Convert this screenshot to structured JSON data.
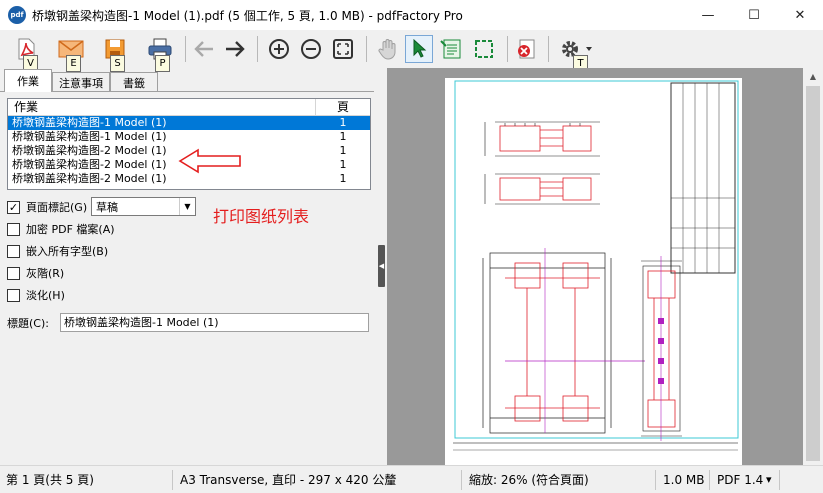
{
  "window": {
    "title": "桥墩钢盖梁构造图-1 Model (1).pdf (5 個工作, 5 頁, 1.0 MB) - pdfFactory Pro",
    "app_icon_text": "pdf",
    "minimize": "—",
    "maximize": "☐",
    "close": "✕"
  },
  "toolbar": {
    "icons": [
      "pdf-icon",
      "email-icon",
      "save-icon",
      "print-icon",
      "back-arrow-icon",
      "forward-arrow-icon",
      "zoom-in-icon",
      "zoom-out-icon",
      "fit-page-icon",
      "hand-icon",
      "select-arrow-icon",
      "text-select-icon",
      "region-select-icon",
      "delete-icon",
      "gear-icon"
    ],
    "key_tips": [
      "V",
      "E",
      "S",
      "P",
      "T"
    ],
    "accent": "#1a8a3a"
  },
  "tabs": [
    "作業",
    "注意事項",
    "書籤"
  ],
  "jobs": {
    "col_job": "作業",
    "col_pages": "頁",
    "rows": [
      {
        "name": "桥墩钢盖梁构造图-1 Model (1)",
        "pages": "1"
      },
      {
        "name": "桥墩钢盖梁构造图-1 Model (1)",
        "pages": "1"
      },
      {
        "name": "桥墩钢盖梁构造图-2 Model (1)",
        "pages": "1"
      },
      {
        "name": "桥墩钢盖梁构造图-2 Model (1)",
        "pages": "1"
      },
      {
        "name": "桥墩钢盖梁构造图-2 Model (1)",
        "pages": "1"
      }
    ]
  },
  "annotation": {
    "text": "打印图纸列表",
    "color": "#e41e1e"
  },
  "options": {
    "page_mark": "頁面標記(G)",
    "page_mark_value": "草稿",
    "encrypt": "加密 PDF 檔案(A)",
    "embed_fonts": "嵌入所有字型(B)",
    "grayscale": "灰階(R)",
    "fade": "淡化(H)",
    "check_mark": "✓"
  },
  "title_field": {
    "label": "標題(C):",
    "value": "桥墩钢盖梁构造图-1 Model (1)"
  },
  "statusbar": {
    "page": "第 1 頁(共 5 頁)",
    "paper": "A3 Transverse, 直印 - 297 x 420 公釐",
    "zoom": "縮放: 26% (符合頁面)",
    "size": "1.0 MB",
    "pdf_version": "PDF 1.4",
    "pdf_version_arrow": "▾"
  }
}
